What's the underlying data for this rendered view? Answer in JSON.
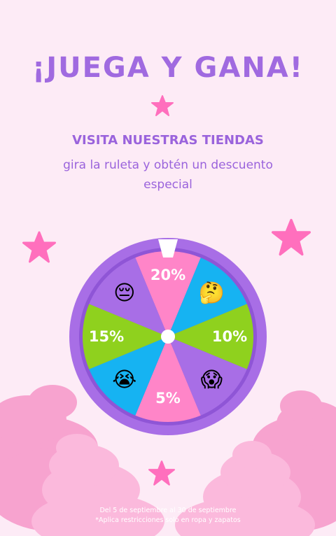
{
  "header": {
    "title": "¡JUEGA Y GANA!",
    "subtitle": "VISITA NUESTRAS TIENDAS",
    "description": "gira la ruleta y obtén un descuento especial"
  },
  "wheel": {
    "segments": [
      {
        "label": "20%",
        "color": "#ff85c8"
      },
      {
        "label": "🤔",
        "color": "#16b3f2"
      },
      {
        "label": "10%",
        "color": "#8fd11e"
      },
      {
        "label": "😱",
        "color": "#a86ee6"
      },
      {
        "label": "5%",
        "color": "#ff85c8"
      },
      {
        "label": "😭",
        "color": "#16b3f2"
      },
      {
        "label": "15%",
        "color": "#8fd11e"
      },
      {
        "label": "😔",
        "color": "#a86ee6"
      }
    ],
    "rim_color": "#a86ee6",
    "hub_color": "#ffffff",
    "pointer_color": "#ffffff"
  },
  "footer": {
    "dates": "Del 5 de septiembre al 30 de septiembre",
    "note": "*Aplica restricciones solo en ropa y zapatos"
  },
  "colors": {
    "background": "#fdebf6",
    "accent_purple": "#a06ae0",
    "star_pink": "#ff6fbd",
    "cloud_pink": "#f79ccd"
  }
}
